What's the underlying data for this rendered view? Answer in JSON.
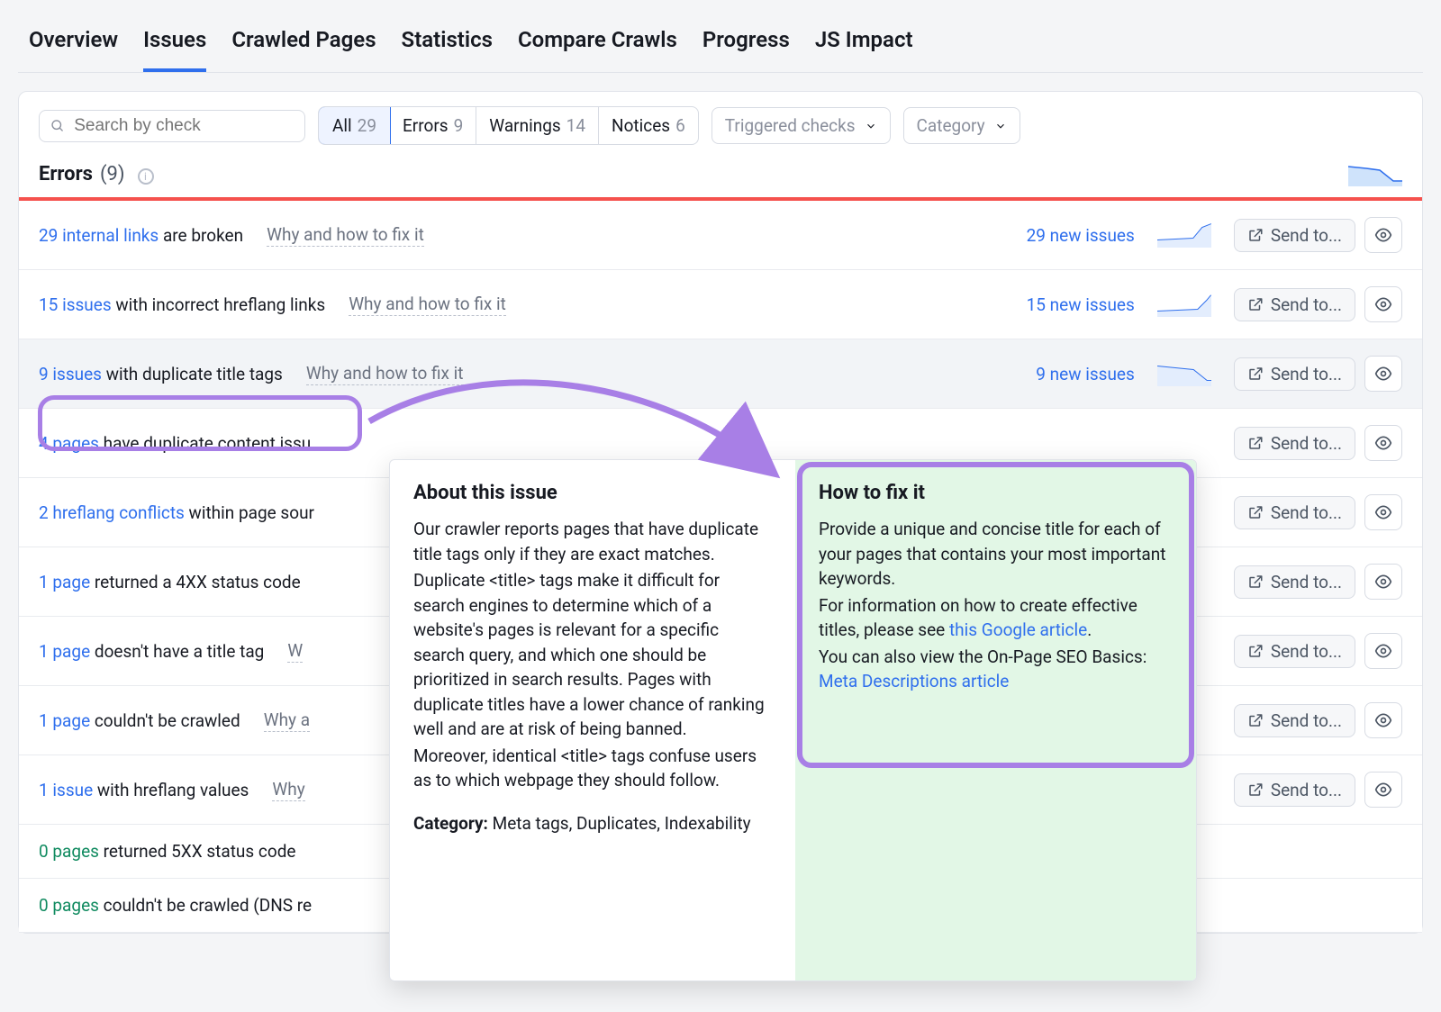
{
  "tabs": [
    "Overview",
    "Issues",
    "Crawled Pages",
    "Statistics",
    "Compare Crawls",
    "Progress",
    "JS Impact"
  ],
  "active_tab_index": 1,
  "search": {
    "placeholder": "Search by check"
  },
  "filters": {
    "segs": [
      {
        "label": "All",
        "count": "29",
        "active": true
      },
      {
        "label": "Errors",
        "count": "9"
      },
      {
        "label": "Warnings",
        "count": "14"
      },
      {
        "label": "Notices",
        "count": "6"
      }
    ],
    "triggered": "Triggered checks",
    "category": "Category"
  },
  "errors_header": {
    "title": "Errors",
    "count": "(9)"
  },
  "rows": [
    {
      "count": "29 internal links",
      "rest": " are broken",
      "why": "Why and how to fix it",
      "new": "29 new issues",
      "actions": true
    },
    {
      "count": "15 issues",
      "rest": " with incorrect hreflang links",
      "why": "Why and how to fix it",
      "new": "15 new issues",
      "actions": true
    },
    {
      "count": "9 issues",
      "rest": " with duplicate title tags",
      "why": "Why and how to fix it",
      "new": "9 new issues",
      "actions": true,
      "highlight": true,
      "outlined": true
    },
    {
      "count": "4 pages",
      "rest": " have duplicate content issu",
      "why": "",
      "new": "",
      "actions": true
    },
    {
      "count": "2 hreflang conflicts",
      "rest": " within page sour",
      "why": "",
      "new": "",
      "actions": true
    },
    {
      "count": "1 page",
      "rest": " returned a 4XX status code",
      "why": "",
      "new": "",
      "actions": true
    },
    {
      "count": "1 page",
      "rest": " doesn't have a title tag",
      "why": "W",
      "new": "",
      "actions": true
    },
    {
      "count": "1 page",
      "rest": " couldn't be crawled",
      "why": "Why a",
      "new": "",
      "actions": true
    },
    {
      "count": "1 issue",
      "rest": " with hreflang values",
      "why": "Why",
      "new": "",
      "actions": true
    },
    {
      "count": "0 pages",
      "rest": " returned 5XX status code",
      "why": "",
      "new": "",
      "zero": true
    },
    {
      "count": "0 pages",
      "rest": " couldn't be crawled (DNS re",
      "why": "",
      "new": "",
      "zero": true
    }
  ],
  "send_label": "Send to...",
  "popup": {
    "about_title": "About this issue",
    "about_body_1": "Our crawler reports pages that have duplicate title tags only if they are exact matches.",
    "about_body_2": "Duplicate <title> tags make it difficult for search engines to determine which of a website's pages is relevant for a specific search query, and which one should be prioritized in search results. Pages with duplicate titles have a lower chance of ranking well and are at risk of being banned.",
    "about_body_3": "Moreover, identical <title> tags confuse users as to which webpage they should follow.",
    "category_label": "Category:",
    "category_value": " Meta tags, Duplicates, Indexability",
    "fix_title": "How to fix it",
    "fix_body_1": "Provide a unique and concise title for each of your pages that contains your most important keywords.",
    "fix_body_2a": "For information on how to create effective titles, please see ",
    "fix_link_1": "this Google article",
    "fix_body_2b": ".",
    "fix_body_3a": "You can also view the On-Page SEO Basics: ",
    "fix_link_2": "Meta Descriptions article"
  }
}
